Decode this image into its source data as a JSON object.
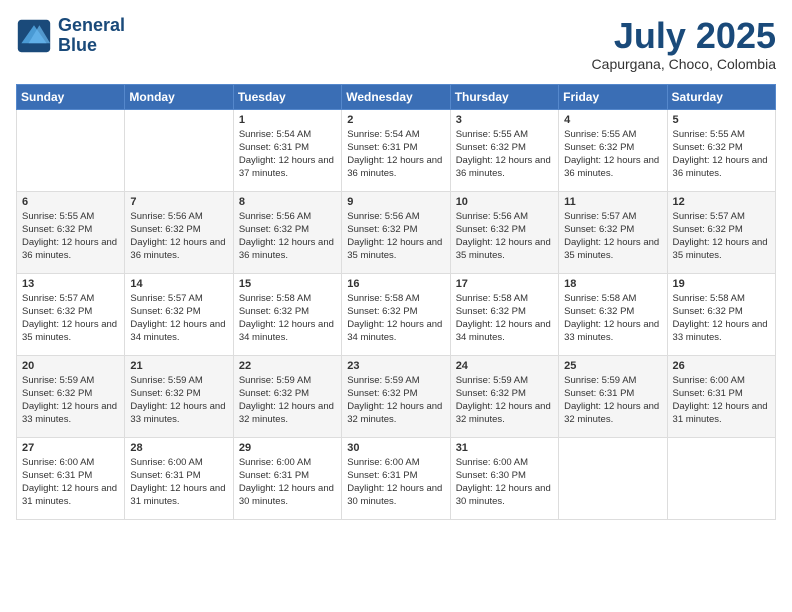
{
  "header": {
    "logo_line1": "General",
    "logo_line2": "Blue",
    "month": "July 2025",
    "location": "Capurgana, Choco, Colombia"
  },
  "weekdays": [
    "Sunday",
    "Monday",
    "Tuesday",
    "Wednesday",
    "Thursday",
    "Friday",
    "Saturday"
  ],
  "weeks": [
    [
      {
        "day": "",
        "info": ""
      },
      {
        "day": "",
        "info": ""
      },
      {
        "day": "1",
        "info": "Sunrise: 5:54 AM\nSunset: 6:31 PM\nDaylight: 12 hours and 37 minutes."
      },
      {
        "day": "2",
        "info": "Sunrise: 5:54 AM\nSunset: 6:31 PM\nDaylight: 12 hours and 36 minutes."
      },
      {
        "day": "3",
        "info": "Sunrise: 5:55 AM\nSunset: 6:32 PM\nDaylight: 12 hours and 36 minutes."
      },
      {
        "day": "4",
        "info": "Sunrise: 5:55 AM\nSunset: 6:32 PM\nDaylight: 12 hours and 36 minutes."
      },
      {
        "day": "5",
        "info": "Sunrise: 5:55 AM\nSunset: 6:32 PM\nDaylight: 12 hours and 36 minutes."
      }
    ],
    [
      {
        "day": "6",
        "info": "Sunrise: 5:55 AM\nSunset: 6:32 PM\nDaylight: 12 hours and 36 minutes."
      },
      {
        "day": "7",
        "info": "Sunrise: 5:56 AM\nSunset: 6:32 PM\nDaylight: 12 hours and 36 minutes."
      },
      {
        "day": "8",
        "info": "Sunrise: 5:56 AM\nSunset: 6:32 PM\nDaylight: 12 hours and 36 minutes."
      },
      {
        "day": "9",
        "info": "Sunrise: 5:56 AM\nSunset: 6:32 PM\nDaylight: 12 hours and 35 minutes."
      },
      {
        "day": "10",
        "info": "Sunrise: 5:56 AM\nSunset: 6:32 PM\nDaylight: 12 hours and 35 minutes."
      },
      {
        "day": "11",
        "info": "Sunrise: 5:57 AM\nSunset: 6:32 PM\nDaylight: 12 hours and 35 minutes."
      },
      {
        "day": "12",
        "info": "Sunrise: 5:57 AM\nSunset: 6:32 PM\nDaylight: 12 hours and 35 minutes."
      }
    ],
    [
      {
        "day": "13",
        "info": "Sunrise: 5:57 AM\nSunset: 6:32 PM\nDaylight: 12 hours and 35 minutes."
      },
      {
        "day": "14",
        "info": "Sunrise: 5:57 AM\nSunset: 6:32 PM\nDaylight: 12 hours and 34 minutes."
      },
      {
        "day": "15",
        "info": "Sunrise: 5:58 AM\nSunset: 6:32 PM\nDaylight: 12 hours and 34 minutes."
      },
      {
        "day": "16",
        "info": "Sunrise: 5:58 AM\nSunset: 6:32 PM\nDaylight: 12 hours and 34 minutes."
      },
      {
        "day": "17",
        "info": "Sunrise: 5:58 AM\nSunset: 6:32 PM\nDaylight: 12 hours and 34 minutes."
      },
      {
        "day": "18",
        "info": "Sunrise: 5:58 AM\nSunset: 6:32 PM\nDaylight: 12 hours and 33 minutes."
      },
      {
        "day": "19",
        "info": "Sunrise: 5:58 AM\nSunset: 6:32 PM\nDaylight: 12 hours and 33 minutes."
      }
    ],
    [
      {
        "day": "20",
        "info": "Sunrise: 5:59 AM\nSunset: 6:32 PM\nDaylight: 12 hours and 33 minutes."
      },
      {
        "day": "21",
        "info": "Sunrise: 5:59 AM\nSunset: 6:32 PM\nDaylight: 12 hours and 33 minutes."
      },
      {
        "day": "22",
        "info": "Sunrise: 5:59 AM\nSunset: 6:32 PM\nDaylight: 12 hours and 32 minutes."
      },
      {
        "day": "23",
        "info": "Sunrise: 5:59 AM\nSunset: 6:32 PM\nDaylight: 12 hours and 32 minutes."
      },
      {
        "day": "24",
        "info": "Sunrise: 5:59 AM\nSunset: 6:32 PM\nDaylight: 12 hours and 32 minutes."
      },
      {
        "day": "25",
        "info": "Sunrise: 5:59 AM\nSunset: 6:31 PM\nDaylight: 12 hours and 32 minutes."
      },
      {
        "day": "26",
        "info": "Sunrise: 6:00 AM\nSunset: 6:31 PM\nDaylight: 12 hours and 31 minutes."
      }
    ],
    [
      {
        "day": "27",
        "info": "Sunrise: 6:00 AM\nSunset: 6:31 PM\nDaylight: 12 hours and 31 minutes."
      },
      {
        "day": "28",
        "info": "Sunrise: 6:00 AM\nSunset: 6:31 PM\nDaylight: 12 hours and 31 minutes."
      },
      {
        "day": "29",
        "info": "Sunrise: 6:00 AM\nSunset: 6:31 PM\nDaylight: 12 hours and 30 minutes."
      },
      {
        "day": "30",
        "info": "Sunrise: 6:00 AM\nSunset: 6:31 PM\nDaylight: 12 hours and 30 minutes."
      },
      {
        "day": "31",
        "info": "Sunrise: 6:00 AM\nSunset: 6:30 PM\nDaylight: 12 hours and 30 minutes."
      },
      {
        "day": "",
        "info": ""
      },
      {
        "day": "",
        "info": ""
      }
    ]
  ]
}
